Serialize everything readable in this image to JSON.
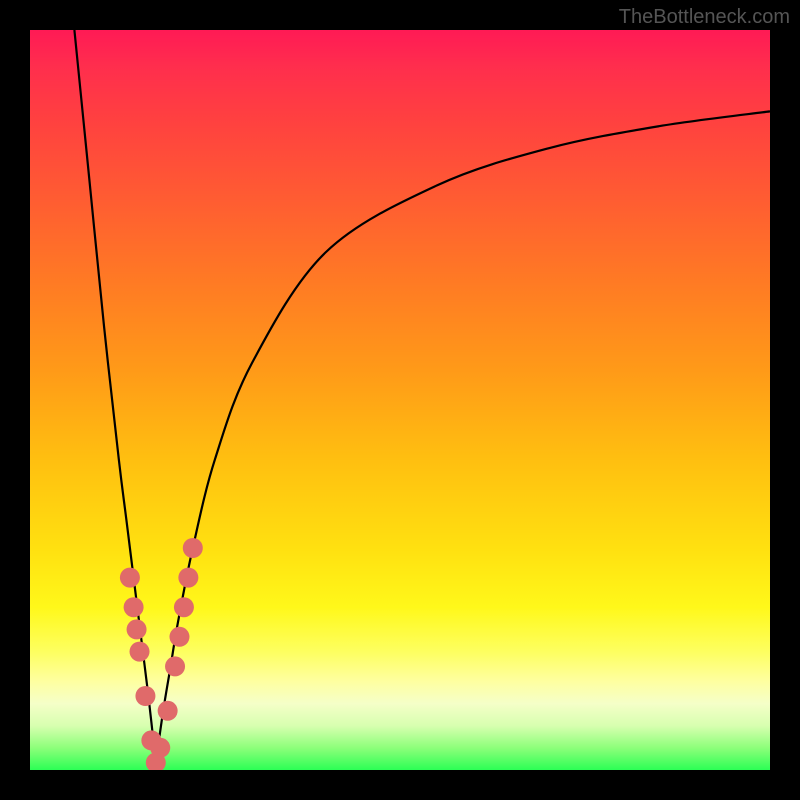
{
  "watermark": "TheBottleneck.com",
  "colors": {
    "frame": "#000000",
    "curve": "#000000",
    "dot": "#e06a6a",
    "gradient_stops": [
      "#ff1a55",
      "#ff4040",
      "#ff9a18",
      "#ffe010",
      "#feffa0",
      "#2cff55"
    ]
  },
  "chart_data": {
    "type": "line",
    "title": "",
    "xlabel": "",
    "ylabel": "",
    "xlim": [
      0,
      100
    ],
    "ylim": [
      0,
      100
    ],
    "notes": "No axes or tick labels are shown; y=0 at bottom (green), y=100 at top (red). Two branches of a V-shaped bottleneck curve meeting near x≈17, y≈0.",
    "series": [
      {
        "name": "left-branch",
        "x": [
          6,
          8,
          10,
          12,
          13,
          14,
          15,
          16,
          17
        ],
        "y": [
          100,
          80,
          60,
          42,
          34,
          26,
          18,
          10,
          1
        ]
      },
      {
        "name": "right-branch",
        "x": [
          17,
          18,
          19,
          20,
          22,
          25,
          30,
          40,
          55,
          70,
          85,
          100
        ],
        "y": [
          1,
          8,
          14,
          20,
          30,
          42,
          55,
          70,
          79,
          84,
          87,
          89
        ]
      }
    ],
    "dots": {
      "name": "highlighted-points",
      "x": [
        13.5,
        14.0,
        14.4,
        14.8,
        15.6,
        16.4,
        17.0,
        17.6,
        18.6,
        19.6,
        20.2,
        20.8,
        21.4,
        22.0
      ],
      "y": [
        26,
        22,
        19,
        16,
        10,
        4,
        1,
        3,
        8,
        14,
        18,
        22,
        26,
        30
      ]
    }
  }
}
